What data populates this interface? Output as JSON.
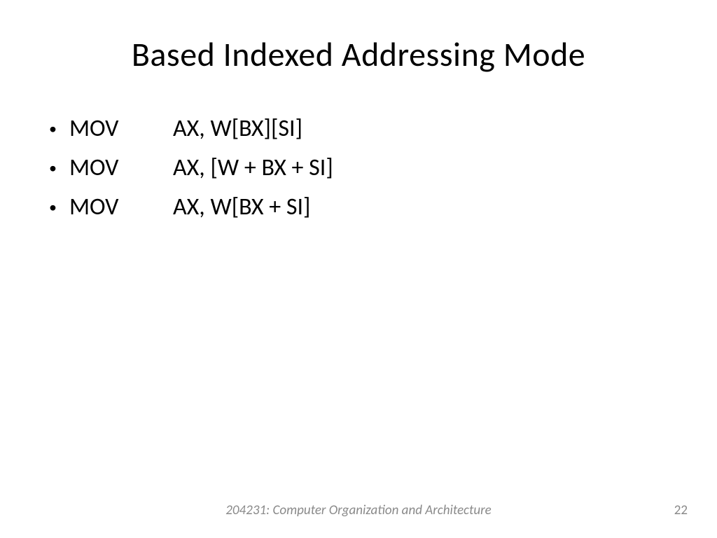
{
  "title": "Based Indexed Addressing Mode",
  "bullets": [
    {
      "op": "MOV",
      "args": "AX, W[BX][SI]"
    },
    {
      "op": "MOV",
      "args": "AX, [W + BX + SI]"
    },
    {
      "op": "MOV",
      "args": "AX, W[BX + SI]"
    }
  ],
  "footer": "204231: Computer Organization and Architecture",
  "page_number": "22"
}
